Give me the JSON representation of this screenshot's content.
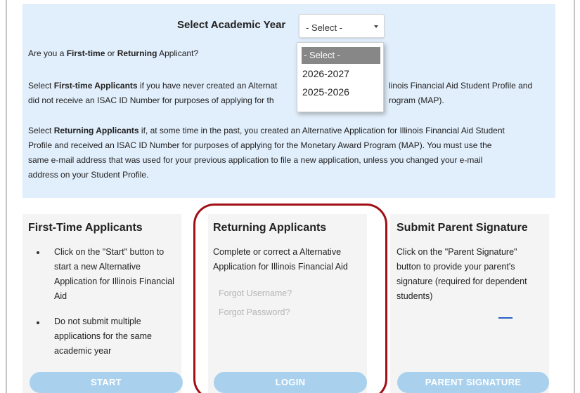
{
  "year_selector": {
    "label": "Select Academic Year",
    "selected_value": "- Select -",
    "options": [
      "- Select -",
      "2026-2027",
      "2025-2026"
    ]
  },
  "intro": {
    "q_prefix": "Are you a ",
    "q_first": "First-time",
    "q_mid": " or ",
    "q_returning": "Returning",
    "q_suffix": " Applicant?",
    "first_l1_pre": "Select ",
    "first_l1_bold": "First-time Applicants",
    "first_l1_post": " if you have never created an Alternat",
    "first_l1_tail": "linois Financial Aid Student Profile and",
    "first_l2": "did not receive an ISAC ID Number for purposes of applying for th",
    "first_l2_tail": "rogram (MAP).",
    "ret_l1_pre": "Select ",
    "ret_l1_bold": "Returning Applicants",
    "ret_l1_post": " if, at some time in the past, you created an Alternative Application for Illinois Financial Aid Student",
    "ret_l2": "Profile and received an ISAC ID Number for purposes of applying for the Monetary Award Program (MAP).  You must use the",
    "ret_l3": "same e-mail address that was used for your previous application to file a new application, unless you changed your e-mail",
    "ret_l4": "address on your Student Profile."
  },
  "first_time": {
    "title": "First-Time Applicants",
    "b1_l1": "Click on the \"Start\" button to",
    "b1_l2": "start a new Alternative",
    "b1_l3": "Application for Illinois Financial",
    "b1_l4": "Aid",
    "b2_l1": "Do not submit multiple",
    "b2_l2": "applications for the same",
    "b2_l3": "academic year",
    "button": "START"
  },
  "returning": {
    "title": "Returning Applicants",
    "desc_l1": "Complete or correct a Alternative",
    "desc_l2": "Application for Illinois Financial Aid",
    "forgot_username": "Forgot Username?",
    "forgot_password": "Forgot Password?",
    "button": "LOGIN"
  },
  "parent": {
    "title": "Submit Parent Signature",
    "desc_l1": "Click on the \"Parent Signature\"",
    "desc_l2": "button to provide your parent's",
    "desc_l3": "signature (required for dependent",
    "desc_l4": "students)",
    "button": "PARENT SIGNATURE"
  },
  "colors": {
    "panel_bg": "#e1eefb",
    "button_bg": "#a9d1ee",
    "highlight_ring": "#a10f16",
    "selected_option_bg": "#878787"
  }
}
